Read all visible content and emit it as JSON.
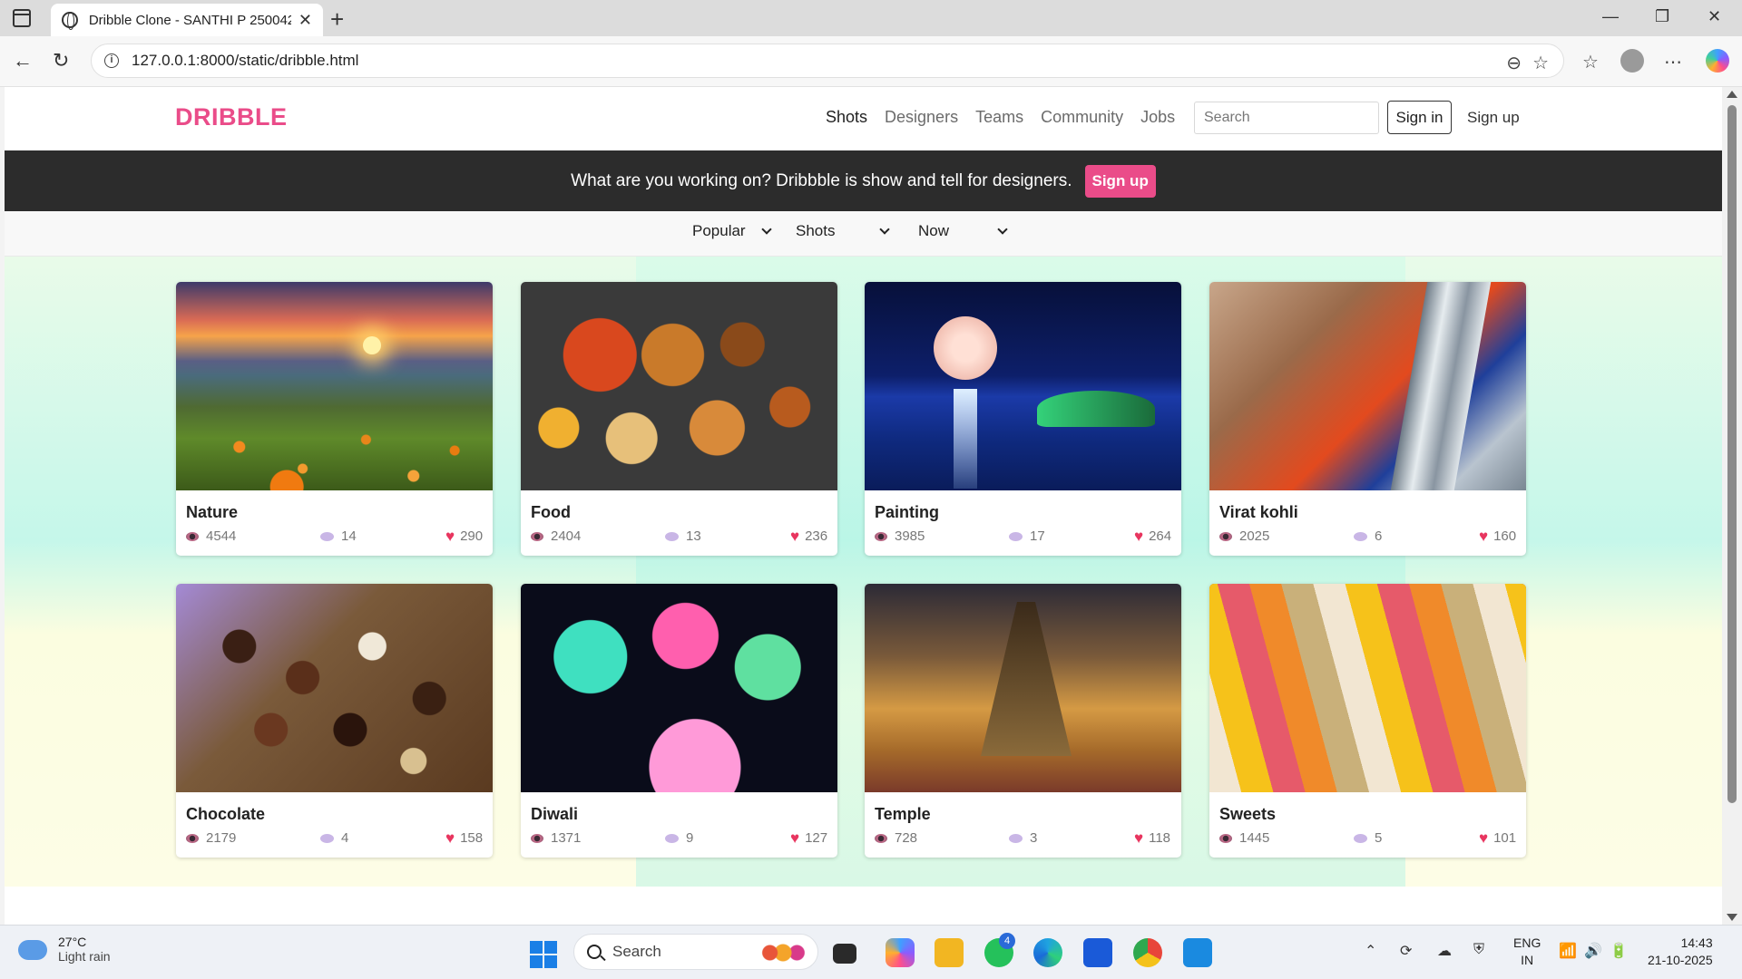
{
  "browser": {
    "tab_title": "Dribble Clone - SANTHI P 250042",
    "url": "127.0.0.1:8000/static/dribble.html",
    "new_tab": "+",
    "minimize": "—",
    "maximize": "❐",
    "close": "✕"
  },
  "site": {
    "logo": "DRIBBLE",
    "nav": [
      "Shots",
      "Designers",
      "Teams",
      "Community",
      "Jobs"
    ],
    "search_placeholder": "Search",
    "signin": "Sign in",
    "signup": "Sign up",
    "accent": "#ea4c89"
  },
  "banner": {
    "text": "What are you working on? Dribbble is show and tell for designers.",
    "button": "Sign up"
  },
  "filters": [
    "Popular",
    "Shots",
    "Now"
  ],
  "cards": [
    {
      "title": "Nature",
      "views": "4544",
      "comments": "14",
      "likes": "290"
    },
    {
      "title": "Food",
      "views": "2404",
      "comments": "13",
      "likes": "236"
    },
    {
      "title": "Painting",
      "views": "3985",
      "comments": "17",
      "likes": "264"
    },
    {
      "title": "Virat kohli",
      "views": "2025",
      "comments": "6",
      "likes": "160"
    },
    {
      "title": "Chocolate",
      "views": "2179",
      "comments": "4",
      "likes": "158"
    },
    {
      "title": "Diwali",
      "views": "1371",
      "comments": "9",
      "likes": "127"
    },
    {
      "title": "Temple",
      "views": "728",
      "comments": "3",
      "likes": "118"
    },
    {
      "title": "Sweets",
      "views": "1445",
      "comments": "5",
      "likes": "101"
    }
  ],
  "taskbar": {
    "temp": "27°C",
    "weather": "Light rain",
    "search": "Search",
    "whatsapp_badge": "4",
    "lang1": "ENG",
    "lang2": "IN",
    "time": "14:43",
    "date": "21-10-2025"
  }
}
